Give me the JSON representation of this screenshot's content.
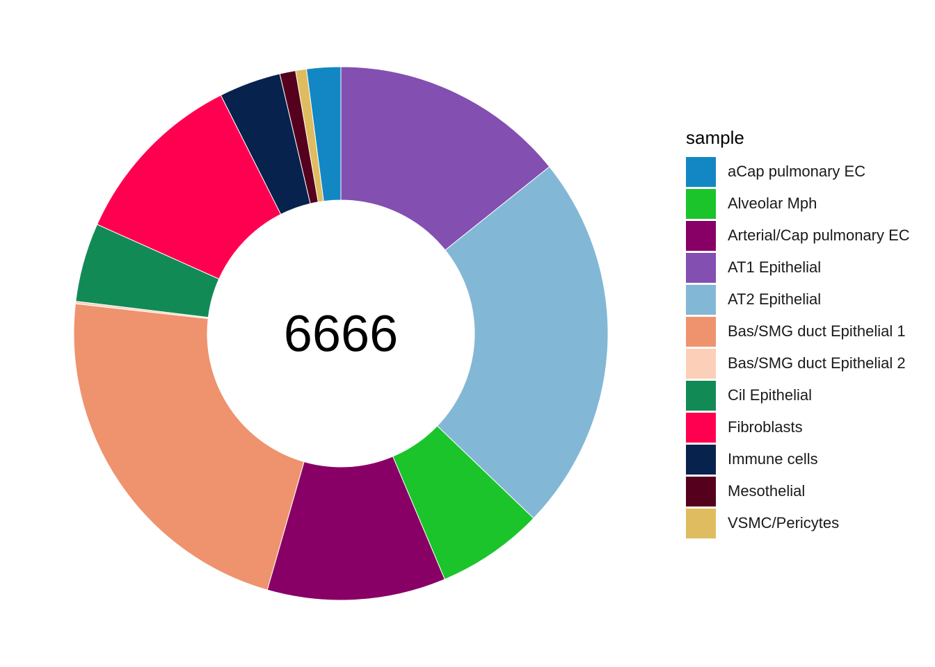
{
  "chart_data": {
    "type": "pie",
    "donut": true,
    "center_label": "6666",
    "legend_title": "sample",
    "legend_position": "right",
    "start": "top",
    "direction": "clockwise",
    "slice_order": [
      "AT1 Epithelial",
      "AT2 Epithelial",
      "Alveolar Mph",
      "Arterial/Cap pulmonary EC",
      "Bas/SMG duct Epithelial 1",
      "Bas/SMG duct Epithelial 2",
      "Cil Epithelial",
      "Fibroblasts",
      "Immune cells",
      "Mesothelial",
      "VSMC/Pericytes",
      "aCap pulmonary EC"
    ],
    "categories": [
      {
        "label": "aCap pulmonary EC",
        "value": 140,
        "color": "#1287c4"
      },
      {
        "label": "Alveolar Mph",
        "value": 440,
        "color": "#1bc42b"
      },
      {
        "label": "Arterial/Cap pulmonary EC",
        "value": 735,
        "color": "#880066"
      },
      {
        "label": "AT1 Epithelial",
        "value": 970,
        "color": "#834fb0"
      },
      {
        "label": "AT2 Epithelial",
        "value": 1560,
        "color": "#83b7d6"
      },
      {
        "label": "Bas/SMG duct Epithelial 1",
        "value": 1520,
        "color": "#ee936e"
      },
      {
        "label": "Bas/SMG duct Epithelial 2",
        "value": 10,
        "color": "#fccfb8"
      },
      {
        "label": "Cil Epithelial",
        "value": 325,
        "color": "#128a55"
      },
      {
        "label": "Fibroblasts",
        "value": 740,
        "color": "#ff0050"
      },
      {
        "label": "Immune cells",
        "value": 255,
        "color": "#08224e"
      },
      {
        "label": "Mesothelial",
        "value": 65,
        "color": "#55001d"
      },
      {
        "label": "VSMC/Pericytes",
        "value": 45,
        "color": "#dfbc5f"
      }
    ]
  }
}
